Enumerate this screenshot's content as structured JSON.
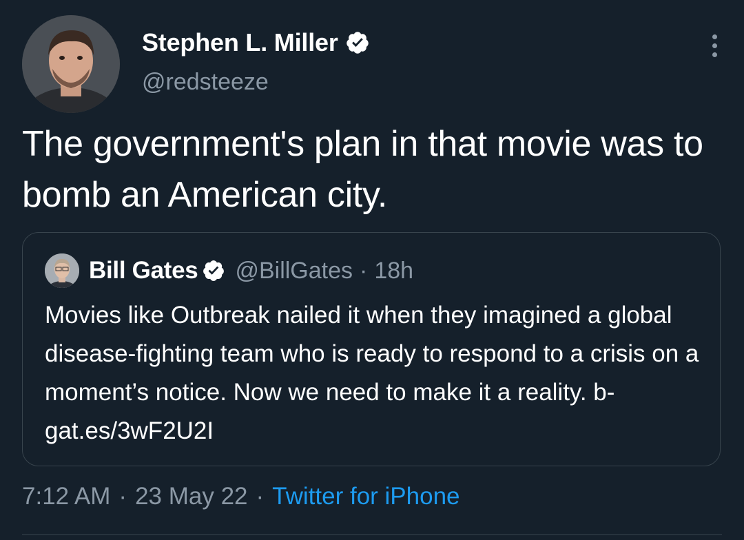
{
  "tweet": {
    "author_name": "Stephen L. Miller",
    "author_handle": "@redsteeze",
    "text": "The government's plan in that movie was to bomb an American city.",
    "time": "7:12 AM",
    "date": "23 May 22",
    "source": "Twitter for iPhone",
    "separator": "·"
  },
  "quoted_tweet": {
    "author_name": "Bill Gates",
    "author_handle": "@BillGates",
    "separator": "·",
    "time_ago": "18h",
    "text": "Movies like Outbreak nailed it when they imagined a global disease-fighting team who is ready to respond to a crisis on a moment’s notice. Now we need to make it a reality. b-gat.es/3wF2U2I"
  },
  "icons": {
    "verified": "verified-badge-icon",
    "more": "more-options-icon"
  },
  "colors": {
    "background": "#15202b",
    "secondary_text": "#8b98a5",
    "link": "#1d9bf0",
    "border": "#38444d"
  }
}
